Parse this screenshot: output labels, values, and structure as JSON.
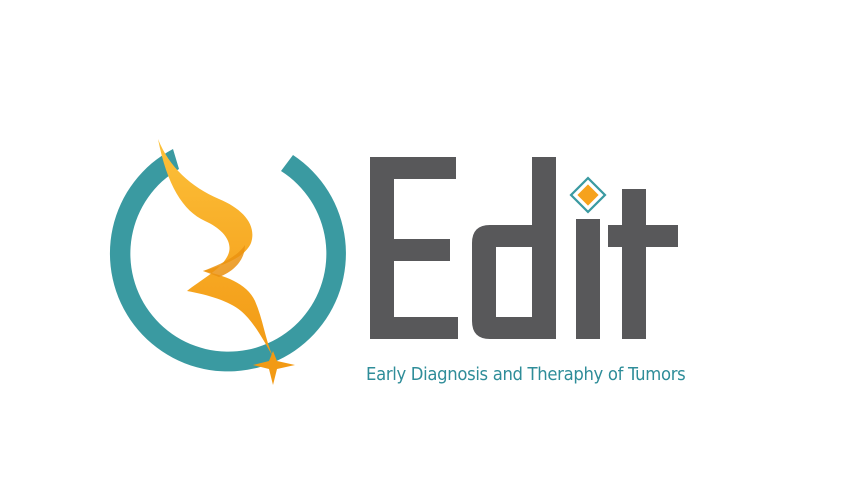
{
  "brand": {
    "name": "Edit",
    "tagline": "Early Diagnosis and Theraphy of Tumors"
  },
  "colors": {
    "teal": "#3a9aa1",
    "orange_light": "#fcc13a",
    "orange_dark": "#f29a14",
    "text_gray": "#58585a",
    "tagline_teal": "#2f8d99"
  },
  "icons": {
    "emblem": "ribbon-circle-emblem-icon",
    "sparkle": "sparkle-star-icon",
    "dot": "diamond-dot-icon"
  }
}
